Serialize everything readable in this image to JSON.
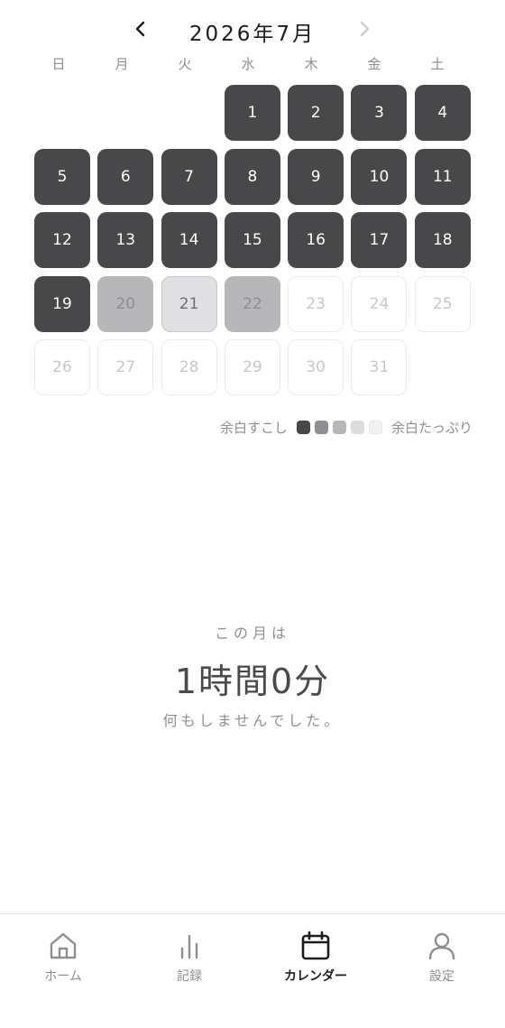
{
  "header": {
    "prev_label": "<",
    "title": "2026年7月"
  },
  "weekdays": [
    "日",
    "月",
    "火",
    "水",
    "木",
    "金",
    "土"
  ],
  "calendar": {
    "first_weekday": 3,
    "days": [
      {
        "day": "1",
        "level": 4
      },
      {
        "day": "2",
        "level": 4
      },
      {
        "day": "3",
        "level": 4
      },
      {
        "day": "4",
        "level": 4
      },
      {
        "day": "5",
        "level": 4
      },
      {
        "day": "6",
        "level": 4
      },
      {
        "day": "7",
        "level": 4
      },
      {
        "day": "8",
        "level": 4
      },
      {
        "day": "9",
        "level": 4
      },
      {
        "day": "10",
        "level": 4
      },
      {
        "day": "11",
        "level": 4
      },
      {
        "day": "12",
        "level": 4
      },
      {
        "day": "13",
        "level": 4
      },
      {
        "day": "14",
        "level": 4
      },
      {
        "day": "15",
        "level": 4
      },
      {
        "day": "16",
        "level": 4
      },
      {
        "day": "17",
        "level": 4
      },
      {
        "day": "18",
        "level": 4
      },
      {
        "day": "19",
        "level": 4
      },
      {
        "day": "20",
        "level": 2
      },
      {
        "day": "21",
        "level": 1
      },
      {
        "day": "22",
        "level": 2
      },
      {
        "day": "23",
        "level": 0
      },
      {
        "day": "24",
        "level": 0
      },
      {
        "day": "25",
        "level": 0
      },
      {
        "day": "26",
        "level": 0
      },
      {
        "day": "27",
        "level": 0
      },
      {
        "day": "28",
        "level": 0
      },
      {
        "day": "29",
        "level": 0
      },
      {
        "day": "30",
        "level": 0
      },
      {
        "day": "31",
        "level": 0
      }
    ]
  },
  "legend": {
    "left_label": "余白すこし",
    "right_label": "余白たっぷり",
    "swatches": [
      "#48484a",
      "#8e8e93",
      "#b7b7ba",
      "#dcdcdf",
      "#f2f2f4"
    ]
  },
  "summary": {
    "label": "この月は",
    "value": "1時間0分",
    "sub": "何もしませんでした。"
  },
  "tabs": [
    {
      "id": "home",
      "label": "ホーム",
      "icon": "home-icon",
      "active": false
    },
    {
      "id": "records",
      "label": "記録",
      "icon": "bar-chart-icon",
      "active": false
    },
    {
      "id": "calendar",
      "label": "カレンダー",
      "icon": "calendar-icon",
      "active": true
    },
    {
      "id": "settings",
      "label": "設定",
      "icon": "person-icon",
      "active": false
    }
  ]
}
